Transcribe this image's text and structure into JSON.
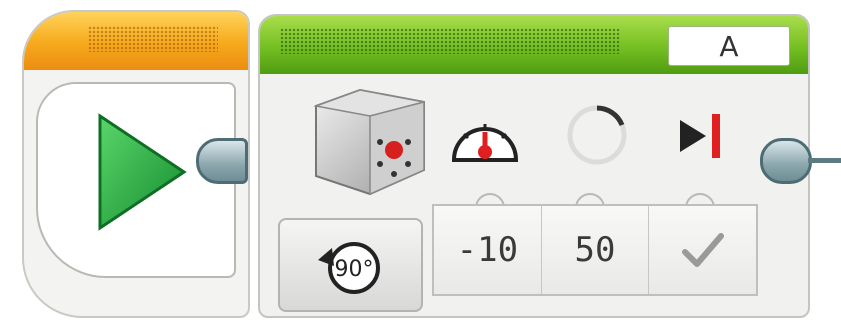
{
  "motor_block": {
    "port_label": "A",
    "parameters": {
      "turn_speed": "-10",
      "power": "50",
      "brake_icon": "check-icon"
    },
    "mode_label": "90°"
  },
  "colors": {
    "start_header": "#f6a91c",
    "motor_header": "#74bf22",
    "play_icon": "#1f9e3a",
    "red_accent": "#e02020"
  },
  "icons": [
    "play-icon",
    "medium-motor-icon",
    "speedometer-icon",
    "degrees-circle-icon",
    "stop-at-end-icon",
    "rotate-degrees-icon",
    "check-icon"
  ]
}
